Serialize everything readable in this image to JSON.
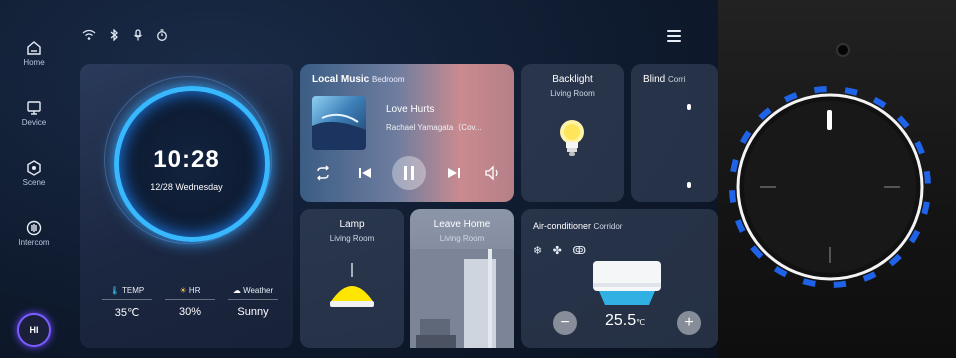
{
  "sidebar": {
    "items": [
      {
        "label": "Home",
        "icon": "home-icon"
      },
      {
        "label": "Device",
        "icon": "monitor-icon"
      },
      {
        "label": "Scene",
        "icon": "scene-icon"
      },
      {
        "label": "Intercom",
        "icon": "intercom-icon"
      }
    ],
    "assistant_label": "HI"
  },
  "status_icons": [
    "wifi-icon",
    "bluetooth-icon",
    "microphone-icon",
    "timer-icon"
  ],
  "clock": {
    "time": "10:28",
    "date": "12/28 Wednesday"
  },
  "weather": {
    "temp": {
      "label": "TEMP",
      "value": "35℃"
    },
    "hr": {
      "label": "HR",
      "value": "30%"
    },
    "weather": {
      "label": "Weather",
      "value": "Sunny"
    }
  },
  "music": {
    "title": "Local Music",
    "room": "Bedroom",
    "song": "Love Hurts",
    "artist": "Rachael Yamagata（Cov..."
  },
  "backlight": {
    "title": "Backlight",
    "room": "Living Room"
  },
  "blind": {
    "title": "Blind",
    "room": "Corri"
  },
  "lamp": {
    "title": "Lamp",
    "room": "Living Room"
  },
  "leave_home": {
    "title": "Leave Home",
    "room": "Living Room"
  },
  "ac": {
    "title": "Air-conditioner",
    "room": "Corridor",
    "temp": "25.5",
    "unit": "℃",
    "minus": "−",
    "plus": "+"
  },
  "colors": {
    "accent": "#37b8ff",
    "assistant": "#7b5cff",
    "lamp_yellow": "#ffe600",
    "knob_blue": "#1f6bff"
  }
}
